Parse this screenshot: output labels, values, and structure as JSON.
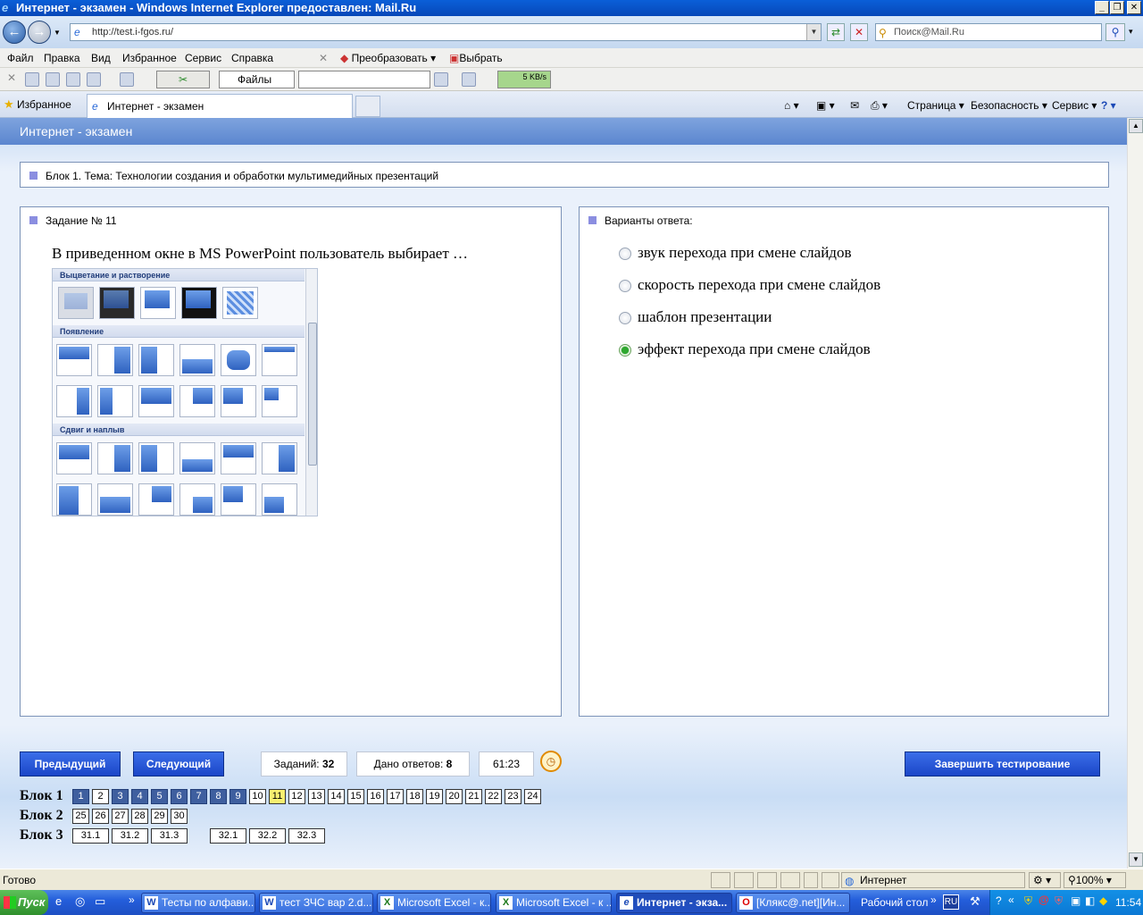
{
  "window": {
    "title": "Интернет - экзамен - Windows Internet Explorer предоставлен: Mail.Ru",
    "minimize": "_",
    "restore": "❐",
    "close": "✕"
  },
  "address": {
    "url": "http://test.i-fgos.ru/",
    "search_placeholder": "Поиск@Mail.Ru"
  },
  "menu": {
    "items": [
      "Файл",
      "Правка",
      "Вид",
      "Избранное",
      "Сервис",
      "Справка"
    ],
    "convert": "Преобразовать",
    "select": "Выбрать"
  },
  "toolbar2": {
    "files_label": "Файлы",
    "speed": "5 KB/s"
  },
  "tabs": {
    "favorites": "Избранное",
    "active_tab": "Интернет - экзамен",
    "page": "Страница",
    "security": "Безопасность",
    "service": "Сервис"
  },
  "page": {
    "header": "Интернет - экзамен",
    "block_title": "Блок 1. Тема: Технологии создания и обработки мультимедийных презентаций",
    "task_title": "Задание № 11",
    "question": "В приведенном окне в MS PowerPoint пользователь выбирает …",
    "answers_title": "Варианты ответа:",
    "options": [
      {
        "text": "звук перехода при смене слайдов",
        "selected": false
      },
      {
        "text": "скорость перехода при смене слайдов",
        "selected": false
      },
      {
        "text": "шаблон презентации",
        "selected": false
      },
      {
        "text": "эффект перехода при смене слайдов",
        "selected": true
      }
    ],
    "ppt": {
      "section1": "Выцветание и растворение",
      "section2": "Появление",
      "section3": "Сдвиг и наплыв"
    }
  },
  "controls": {
    "prev": "Предыдущий",
    "next": "Следующий",
    "tasks_label": "Заданий:",
    "tasks_value": "32",
    "answers_label": "Дано ответов:",
    "answers_value": "8",
    "timer": "61:23",
    "finish": "Завершить тестирование"
  },
  "blocks": [
    {
      "label": "Блок 1",
      "items": [
        "1",
        "2",
        "3",
        "4",
        "5",
        "6",
        "7",
        "8",
        "9",
        "10",
        "11",
        "12",
        "13",
        "14",
        "15",
        "16",
        "17",
        "18",
        "19",
        "20",
        "21",
        "22",
        "23",
        "24"
      ]
    },
    {
      "label": "Блок 2",
      "items": [
        "25",
        "26",
        "27",
        "28",
        "29",
        "30"
      ]
    },
    {
      "label": "Блок 3",
      "items": [
        "31.1",
        "31.2",
        "31.3",
        "32.1",
        "32.2",
        "32.3"
      ]
    }
  ],
  "status": {
    "left": "Готово",
    "zone": "Интернет",
    "zoom": "100%"
  },
  "taskbar": {
    "start": "Пуск",
    "tasks": [
      "Тесты по алфави...",
      "тест ЗЧС вар 2.d...",
      "Microsoft Excel - к...",
      "Microsoft Excel - к ...",
      "Интернет - экза...",
      "[Клякс@.net][Ин..."
    ],
    "desktop": "Рабочий стол",
    "lang": "RU",
    "time": "11:54"
  },
  "colors": {
    "header_blue": "#5b86cf",
    "button_blue": "#1b46c8",
    "done_cell": "#3f5f9f",
    "current_cell": "#f8f070",
    "selected_radio": "#2fa82f"
  }
}
